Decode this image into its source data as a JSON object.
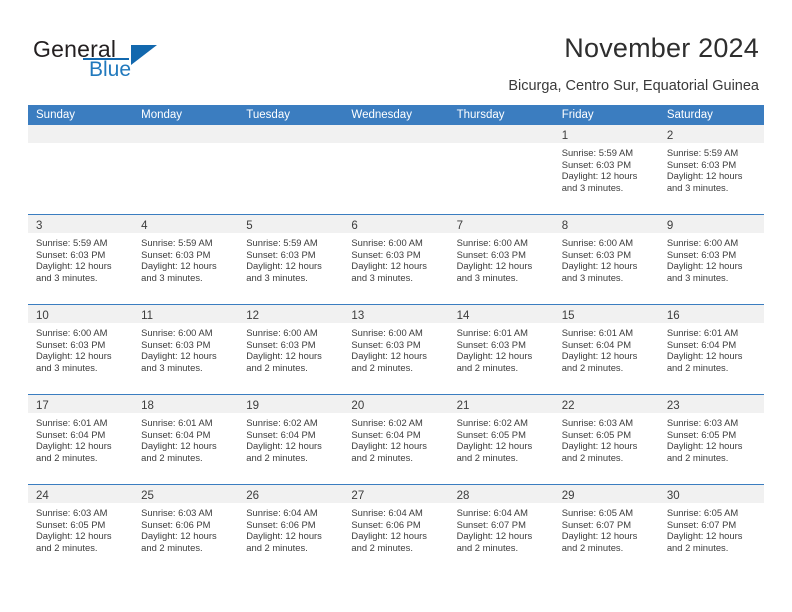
{
  "brand": {
    "name_part1": "General",
    "name_part2": "Blue",
    "logo_icon": "triangle-flag-icon"
  },
  "header": {
    "title": "November 2024",
    "subtitle": "Bicurga, Centro Sur, Equatorial Guinea"
  },
  "colors": {
    "header_blue": "#3b7dc0",
    "brand_blue": "#2179bd",
    "date_bar_gray": "#f1f1f1"
  },
  "calendar": {
    "weekdays": [
      "Sunday",
      "Monday",
      "Tuesday",
      "Wednesday",
      "Thursday",
      "Friday",
      "Saturday"
    ],
    "weeks": [
      [
        {
          "day": "",
          "lines": []
        },
        {
          "day": "",
          "lines": []
        },
        {
          "day": "",
          "lines": []
        },
        {
          "day": "",
          "lines": []
        },
        {
          "day": "",
          "lines": []
        },
        {
          "day": "1",
          "lines": [
            "Sunrise: 5:59 AM",
            "Sunset: 6:03 PM",
            "Daylight: 12 hours",
            "and 3 minutes."
          ]
        },
        {
          "day": "2",
          "lines": [
            "Sunrise: 5:59 AM",
            "Sunset: 6:03 PM",
            "Daylight: 12 hours",
            "and 3 minutes."
          ]
        }
      ],
      [
        {
          "day": "3",
          "lines": [
            "Sunrise: 5:59 AM",
            "Sunset: 6:03 PM",
            "Daylight: 12 hours",
            "and 3 minutes."
          ]
        },
        {
          "day": "4",
          "lines": [
            "Sunrise: 5:59 AM",
            "Sunset: 6:03 PM",
            "Daylight: 12 hours",
            "and 3 minutes."
          ]
        },
        {
          "day": "5",
          "lines": [
            "Sunrise: 5:59 AM",
            "Sunset: 6:03 PM",
            "Daylight: 12 hours",
            "and 3 minutes."
          ]
        },
        {
          "day": "6",
          "lines": [
            "Sunrise: 6:00 AM",
            "Sunset: 6:03 PM",
            "Daylight: 12 hours",
            "and 3 minutes."
          ]
        },
        {
          "day": "7",
          "lines": [
            "Sunrise: 6:00 AM",
            "Sunset: 6:03 PM",
            "Daylight: 12 hours",
            "and 3 minutes."
          ]
        },
        {
          "day": "8",
          "lines": [
            "Sunrise: 6:00 AM",
            "Sunset: 6:03 PM",
            "Daylight: 12 hours",
            "and 3 minutes."
          ]
        },
        {
          "day": "9",
          "lines": [
            "Sunrise: 6:00 AM",
            "Sunset: 6:03 PM",
            "Daylight: 12 hours",
            "and 3 minutes."
          ]
        }
      ],
      [
        {
          "day": "10",
          "lines": [
            "Sunrise: 6:00 AM",
            "Sunset: 6:03 PM",
            "Daylight: 12 hours",
            "and 3 minutes."
          ]
        },
        {
          "day": "11",
          "lines": [
            "Sunrise: 6:00 AM",
            "Sunset: 6:03 PM",
            "Daylight: 12 hours",
            "and 3 minutes."
          ]
        },
        {
          "day": "12",
          "lines": [
            "Sunrise: 6:00 AM",
            "Sunset: 6:03 PM",
            "Daylight: 12 hours",
            "and 2 minutes."
          ]
        },
        {
          "day": "13",
          "lines": [
            "Sunrise: 6:00 AM",
            "Sunset: 6:03 PM",
            "Daylight: 12 hours",
            "and 2 minutes."
          ]
        },
        {
          "day": "14",
          "lines": [
            "Sunrise: 6:01 AM",
            "Sunset: 6:03 PM",
            "Daylight: 12 hours",
            "and 2 minutes."
          ]
        },
        {
          "day": "15",
          "lines": [
            "Sunrise: 6:01 AM",
            "Sunset: 6:04 PM",
            "Daylight: 12 hours",
            "and 2 minutes."
          ]
        },
        {
          "day": "16",
          "lines": [
            "Sunrise: 6:01 AM",
            "Sunset: 6:04 PM",
            "Daylight: 12 hours",
            "and 2 minutes."
          ]
        }
      ],
      [
        {
          "day": "17",
          "lines": [
            "Sunrise: 6:01 AM",
            "Sunset: 6:04 PM",
            "Daylight: 12 hours",
            "and 2 minutes."
          ]
        },
        {
          "day": "18",
          "lines": [
            "Sunrise: 6:01 AM",
            "Sunset: 6:04 PM",
            "Daylight: 12 hours",
            "and 2 minutes."
          ]
        },
        {
          "day": "19",
          "lines": [
            "Sunrise: 6:02 AM",
            "Sunset: 6:04 PM",
            "Daylight: 12 hours",
            "and 2 minutes."
          ]
        },
        {
          "day": "20",
          "lines": [
            "Sunrise: 6:02 AM",
            "Sunset: 6:04 PM",
            "Daylight: 12 hours",
            "and 2 minutes."
          ]
        },
        {
          "day": "21",
          "lines": [
            "Sunrise: 6:02 AM",
            "Sunset: 6:05 PM",
            "Daylight: 12 hours",
            "and 2 minutes."
          ]
        },
        {
          "day": "22",
          "lines": [
            "Sunrise: 6:03 AM",
            "Sunset: 6:05 PM",
            "Daylight: 12 hours",
            "and 2 minutes."
          ]
        },
        {
          "day": "23",
          "lines": [
            "Sunrise: 6:03 AM",
            "Sunset: 6:05 PM",
            "Daylight: 12 hours",
            "and 2 minutes."
          ]
        }
      ],
      [
        {
          "day": "24",
          "lines": [
            "Sunrise: 6:03 AM",
            "Sunset: 6:05 PM",
            "Daylight: 12 hours",
            "and 2 minutes."
          ]
        },
        {
          "day": "25",
          "lines": [
            "Sunrise: 6:03 AM",
            "Sunset: 6:06 PM",
            "Daylight: 12 hours",
            "and 2 minutes."
          ]
        },
        {
          "day": "26",
          "lines": [
            "Sunrise: 6:04 AM",
            "Sunset: 6:06 PM",
            "Daylight: 12 hours",
            "and 2 minutes."
          ]
        },
        {
          "day": "27",
          "lines": [
            "Sunrise: 6:04 AM",
            "Sunset: 6:06 PM",
            "Daylight: 12 hours",
            "and 2 minutes."
          ]
        },
        {
          "day": "28",
          "lines": [
            "Sunrise: 6:04 AM",
            "Sunset: 6:07 PM",
            "Daylight: 12 hours",
            "and 2 minutes."
          ]
        },
        {
          "day": "29",
          "lines": [
            "Sunrise: 6:05 AM",
            "Sunset: 6:07 PM",
            "Daylight: 12 hours",
            "and 2 minutes."
          ]
        },
        {
          "day": "30",
          "lines": [
            "Sunrise: 6:05 AM",
            "Sunset: 6:07 PM",
            "Daylight: 12 hours",
            "and 2 minutes."
          ]
        }
      ]
    ]
  }
}
